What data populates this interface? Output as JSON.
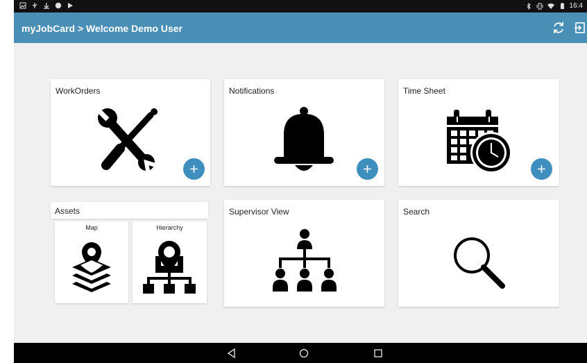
{
  "status_bar": {
    "time": "16:4",
    "left_icons": [
      "image-icon",
      "usb-icon",
      "download-icon",
      "globe-icon",
      "play-icon"
    ],
    "right_icons": [
      "bluetooth-icon",
      "vibrate-icon",
      "wifi-icon",
      "battery-icon"
    ]
  },
  "app_bar": {
    "title": "myJobCard > Welcome Demo User",
    "background": "#4a8fb5",
    "actions": [
      "sync-icon",
      "logout-icon"
    ]
  },
  "cards": {
    "workorders": {
      "title": "WorkOrders",
      "icon": "tools-icon",
      "has_add": true
    },
    "notifications": {
      "title": "Notifications",
      "icon": "bell-icon",
      "has_add": true
    },
    "timesheet": {
      "title": "Time Sheet",
      "icon": "calendar-clock-icon",
      "has_add": true
    },
    "supervisor": {
      "title": "Supervisor View",
      "icon": "org-chart-icon"
    },
    "search": {
      "title": "Search",
      "icon": "magnifier-icon"
    }
  },
  "assets": {
    "title": "Assets",
    "map": {
      "label": "Map",
      "icon": "map-layers-icon"
    },
    "hierarchy": {
      "label": "Hierarchy",
      "icon": "location-hierarchy-icon"
    }
  },
  "fab_color": "#3f8fbe",
  "nav_bar": {
    "buttons": [
      "back-icon",
      "home-icon",
      "recents-icon"
    ]
  }
}
